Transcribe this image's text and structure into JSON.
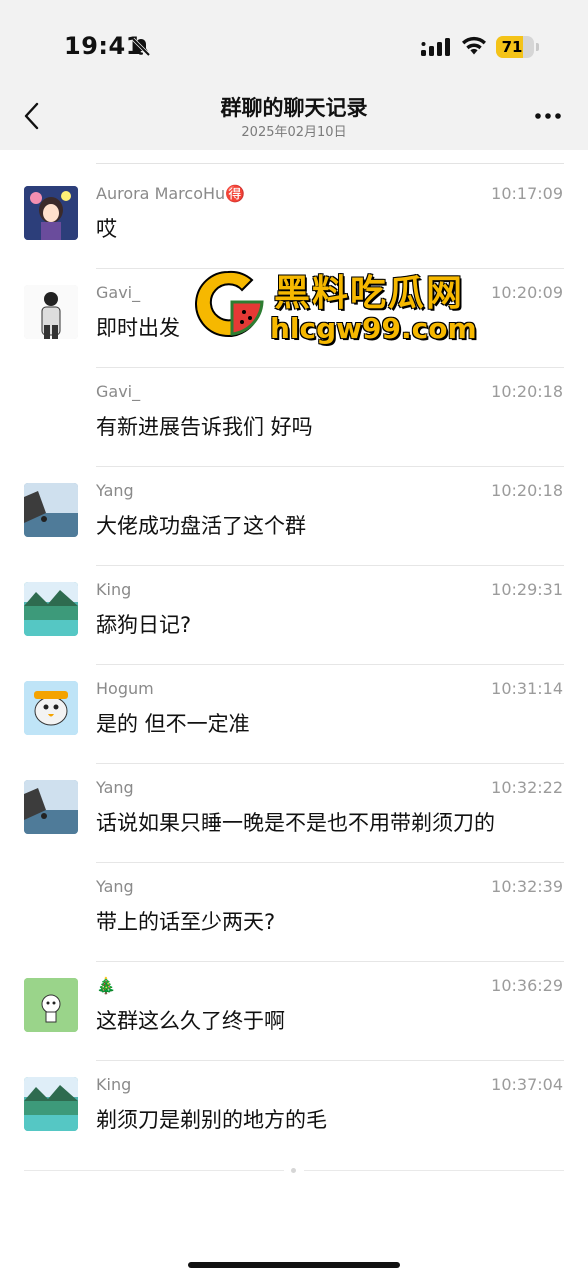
{
  "status_bar": {
    "time": "19:41",
    "battery": "71",
    "battery_level": 0.71,
    "icons": [
      "bell-off-icon",
      "signal-icon",
      "wifi-icon",
      "battery-icon"
    ]
  },
  "header": {
    "title": "群聊的聊天记录",
    "subtitle": "2025年02月10日",
    "back_icon": "chevron-left-icon",
    "more_icon": "more-icon"
  },
  "messages": [
    {
      "sender": "Aurora MarcoHu🉐",
      "time": "10:17:09",
      "text": "哎",
      "avatar": "anime-girl",
      "color": "#3a4f8c"
    },
    {
      "sender": "Gavi_",
      "time": "10:20:09",
      "text": "即时出发",
      "avatar": "person-bw",
      "color": "#e8e8e8"
    },
    {
      "sender": "Gavi_",
      "time": "10:20:18",
      "text": "有新进展告诉我们 好吗",
      "avatar": "",
      "color": ""
    },
    {
      "sender": "Yang",
      "time": "10:20:18",
      "text": "大佬成功盘活了这个群",
      "avatar": "seaside",
      "color": "#7aa2c0"
    },
    {
      "sender": "King",
      "time": "10:29:31",
      "text": "舔狗日记?",
      "avatar": "mountain-lake",
      "color": "#4fb3b0"
    },
    {
      "sender": "Hogum",
      "time": "10:31:14",
      "text": "是的 但不一定准",
      "avatar": "cartoon-goose",
      "color": "#9fd3f0"
    },
    {
      "sender": "Yang",
      "time": "10:32:22",
      "text": "话说如果只睡一晚是不是也不用带剃须刀的",
      "avatar": "seaside",
      "color": "#7aa2c0"
    },
    {
      "sender": "Yang",
      "time": "10:32:39",
      "text": "带上的话至少两天?",
      "avatar": "",
      "color": ""
    },
    {
      "sender": "🎄",
      "time": "10:36:29",
      "text": "这群这么久了终于啊",
      "avatar": "green-cartoon",
      "color": "#8bd07a"
    },
    {
      "sender": "King",
      "time": "10:37:04",
      "text": "剃须刀是剃别的地方的毛",
      "avatar": "mountain-lake",
      "color": "#4fb3b0"
    }
  ],
  "watermark": {
    "title": "黑料吃瓜网",
    "url": "hlcgw99.com",
    "colors": {
      "primary": "#f6b800",
      "secondary": "#e53935"
    }
  }
}
